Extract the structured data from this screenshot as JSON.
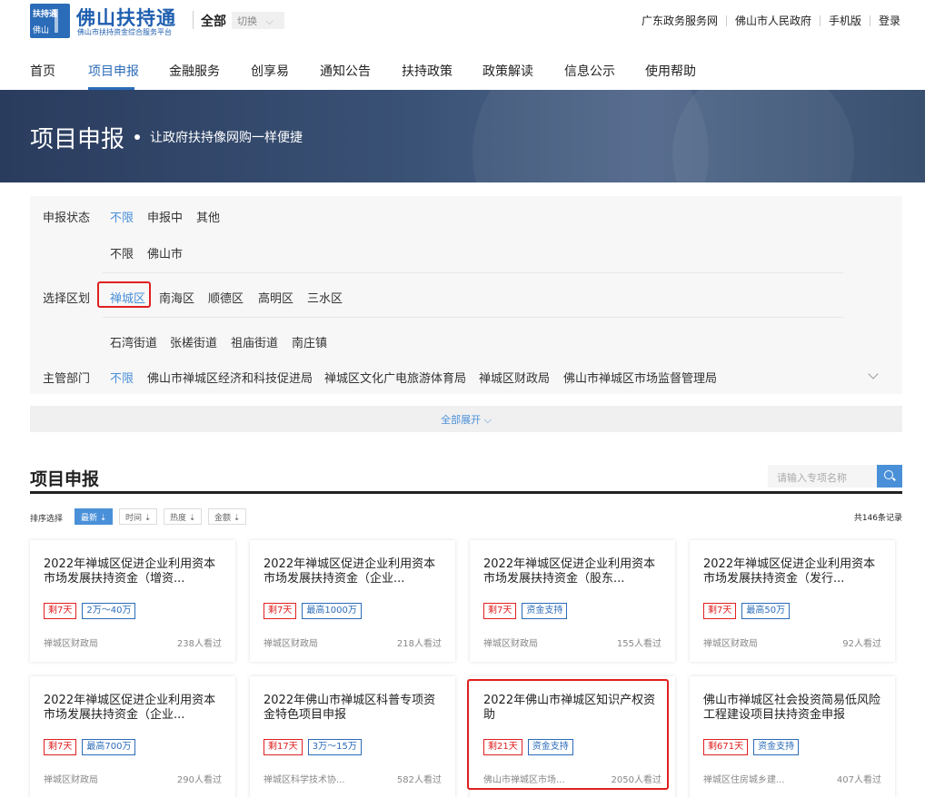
{
  "header": {
    "logo_text_top": "扶持通",
    "logo_text_bottom": "佛山",
    "brand": "佛山扶持通",
    "brand_sub": "佛山市扶持资金综合服务平台",
    "region": "全部",
    "switch_label": "切换",
    "links": [
      "广东政务服务网",
      "佛山市人民政府",
      "手机版",
      "登录"
    ]
  },
  "nav": {
    "items": [
      "首页",
      "项目申报",
      "金融服务",
      "创享易",
      "通知公告",
      "扶持政策",
      "政策解读",
      "信息公示",
      "使用帮助"
    ],
    "active": "项目申报"
  },
  "banner": {
    "title": "项目申报",
    "slogan": "让政府扶持像网购一样便捷"
  },
  "filter": {
    "status": {
      "label": "申报状态",
      "options": [
        "不限",
        "申报中",
        "其他"
      ],
      "selected": "不限"
    },
    "area": {
      "label": "选择区划",
      "level1": [
        "不限",
        "佛山市"
      ],
      "level2": [
        "禅城区",
        "南海区",
        "顺德区",
        "高明区",
        "三水区"
      ],
      "level2_selected": "禅城区",
      "level3": [
        "石湾街道",
        "张槎街道",
        "祖庙街道",
        "南庄镇"
      ]
    },
    "dept": {
      "label": "主管部门",
      "options": [
        "不限",
        "佛山市禅城区经济和科技促进局",
        "禅城区文化广电旅游体育局",
        "禅城区财政局",
        "佛山市禅城区市场监督管理局"
      ],
      "selected": "不限"
    },
    "expand_all": "全部展开"
  },
  "section": {
    "title": "项目申报",
    "search_placeholder": "请输入专项名称",
    "sort_label": "排序选择",
    "sorts": [
      "最新 ⇣",
      "时间 ⇣",
      "热度 ⇣",
      "金额 ⇣"
    ],
    "total": "共146条记录"
  },
  "cards": [
    {
      "title": "2022年禅城区促进企业利用资本市场发展扶持资金（增资...",
      "days": "剩7天",
      "tag": "2万～40万",
      "dept": "禅城区财政局",
      "views": "238人看过"
    },
    {
      "title": "2022年禅城区促进企业利用资本市场发展扶持资金（企业...",
      "days": "剩7天",
      "tag": "最高1000万",
      "dept": "禅城区财政局",
      "views": "218人看过"
    },
    {
      "title": "2022年禅城区促进企业利用资本市场发展扶持资金（股东...",
      "days": "剩7天",
      "tag": "资金支持",
      "dept": "禅城区财政局",
      "views": "155人看过"
    },
    {
      "title": "2022年禅城区促进企业利用资本市场发展扶持资金（发行...",
      "days": "剩7天",
      "tag": "最高50万",
      "dept": "禅城区财政局",
      "views": "92人看过"
    },
    {
      "title": "2022年禅城区促进企业利用资本市场发展扶持资金（企业...",
      "days": "剩7天",
      "tag": "最高700万",
      "dept": "禅城区财政局",
      "views": "290人看过"
    },
    {
      "title": "2022年佛山市禅城区科普专项资金特色项目申报",
      "days": "剩17天",
      "tag": "3万～15万",
      "dept": "禅城区科学技术协...",
      "views": "582人看过"
    },
    {
      "title": "2022年佛山市禅城区知识产权资助",
      "days": "剩21天",
      "tag": "资金支持",
      "dept": "佛山市禅城区市场...",
      "views": "2050人看过"
    },
    {
      "title": "佛山市禅城区社会投资简易低风险工程建设项目扶持资金申报",
      "days": "剩671天",
      "tag": "资金支持",
      "dept": "禅城区住房城乡建...",
      "views": "407人看过"
    }
  ]
}
